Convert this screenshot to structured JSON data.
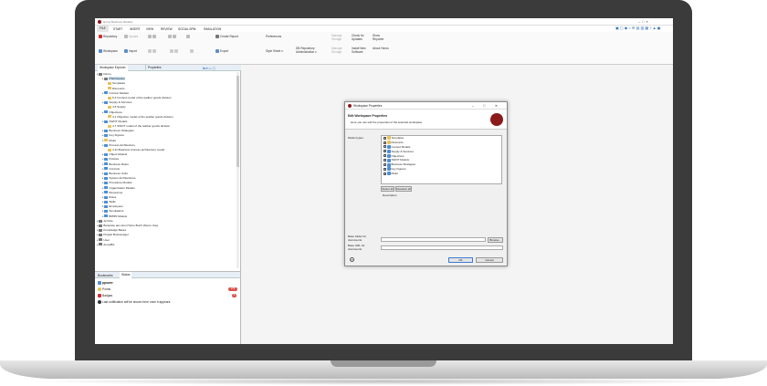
{
  "window": {
    "title": "Horus Business Modeler"
  },
  "menu": [
    "FILE",
    "START",
    "INSERT",
    "VIEW",
    "REVIEW",
    "SOCIAL BPM",
    "SIMULATION"
  ],
  "ribbon": {
    "repository": "Repository",
    "upload": "Upload",
    "import": "Import",
    "workspace": "Workspace",
    "create_report": "Create Report",
    "preferences": "Preferences",
    "style_sheet": "Style Sheet",
    "db_repository": "DB Repository Administration",
    "check_updates": "Check for Updates",
    "install_new_software": "Install New Software",
    "show_reporter": "Show Reporter",
    "about_horus": "About Horus",
    "export": "Export",
    "manage_storage": "Manage Storage",
    "manage_storage2": "Manage Storage"
  },
  "explorer": {
    "tabs": [
      "Workspace Explorer",
      "Properties"
    ],
    "tree": [
      {
        "label": "Demo",
        "level": 0,
        "color": "#7a7a7a"
      },
      {
        "label": "PWorkspace",
        "level": 1,
        "color": "#7a7a7a",
        "selected": true
      },
      {
        "label": "Templates",
        "level": 2,
        "color": "#e6c35a"
      },
      {
        "label": "Discounts",
        "level": 2,
        "color": "#e6c35a"
      },
      {
        "label": "Context Models",
        "level": 1,
        "color": "#4a8fd6"
      },
      {
        "label": "6.4 Context model of the leather goods division",
        "level": 2,
        "color": "#e6c35a"
      },
      {
        "label": "Supply & Services",
        "level": 1,
        "color": "#4a8fd6"
      },
      {
        "label": "4.5 Supply",
        "level": 2,
        "color": "#e6c35a"
      },
      {
        "label": "Objectives",
        "level": 1,
        "color": "#4a8fd6"
      },
      {
        "label": "4.1 Objective model of the leather goods division",
        "level": 2,
        "color": "#e6c35a"
      },
      {
        "label": "SWOT Models",
        "level": 1,
        "color": "#4a8fd6"
      },
      {
        "label": "4.7 SWOT model of the leather goods division",
        "level": 2,
        "color": "#e6c35a"
      },
      {
        "label": "Business Strategies",
        "level": 1,
        "color": "#4a8fd6"
      },
      {
        "label": "Key Figures",
        "level": 1,
        "color": "#4a8fd6"
      },
      {
        "label": "Risks",
        "level": 1,
        "color": "#e6c35a"
      },
      {
        "label": "Process Architecture",
        "level": 1,
        "color": "#4a8fd6"
      },
      {
        "label": "4.11 Business process architecture model",
        "level": 2,
        "color": "#e6c35a"
      },
      {
        "label": "Object Models",
        "level": 1,
        "color": "#4a8fd6"
      },
      {
        "label": "Policies",
        "level": 1,
        "color": "#4a8fd6"
      },
      {
        "label": "Business Rules",
        "level": 1,
        "color": "#4a8fd6"
      },
      {
        "label": "Controls",
        "level": 1,
        "color": "#4a8fd6"
      },
      {
        "label": "Business Units",
        "level": 1,
        "color": "#4a8fd6"
      },
      {
        "label": "System Architectures",
        "level": 1,
        "color": "#4a8fd6"
      },
      {
        "label": "Procedure Models",
        "level": 1,
        "color": "#4a8fd6"
      },
      {
        "label": "Organization Models",
        "level": 1,
        "color": "#4a8fd6"
      },
      {
        "label": "Resources",
        "level": 1,
        "color": "#4a8fd6"
      },
      {
        "label": "Roles",
        "level": 1,
        "color": "#4a8fd6"
      },
      {
        "label": "Skills",
        "level": 1,
        "color": "#4a8fd6"
      },
      {
        "label": "Employees",
        "level": 1,
        "color": "#4a8fd6"
      },
      {
        "label": "Simulations",
        "level": 1,
        "color": "#4a8fd6"
      },
      {
        "label": "BPMN Models",
        "level": 1,
        "color": "#4a8fd6"
      },
      {
        "label": "Archive",
        "level": 0,
        "color": "#7a7a7a"
      },
      {
        "label": "Beispiele aus dem Horus Buch (Demo Use)",
        "level": 0,
        "color": "#7a7a7a"
      },
      {
        "label": "Knowledge Bases",
        "level": 0,
        "color": "#7a7a7a"
      },
      {
        "label": "Projekt Businessgel",
        "level": 0,
        "color": "#7a7a7a"
      },
      {
        "label": "User",
        "level": 0,
        "color": "#7a7a7a"
      },
      {
        "label": "demoBis",
        "level": 0,
        "color": "#7a7a7a"
      }
    ]
  },
  "status": {
    "tabs": [
      "Bookmarks",
      "Status"
    ],
    "user": "ppower",
    "points_label": "Points",
    "points_value": "275",
    "badges_label": "Badges",
    "badges_value": "5",
    "notification": "Last notification will be shown here once it appears"
  },
  "dialog": {
    "title": "Workspace Properties",
    "heading": "Edit Workspace Properties",
    "subheading": "Here you can edit the properties of the selected workspace.",
    "model_types_label": "Model types:",
    "model_types": [
      "Templates",
      "Discounts",
      "Context Models",
      "Supply & Services",
      "Objectives",
      "SWOT Models",
      "Business Strategies",
      "Key Figures",
      "Risks"
    ],
    "select_all": "Select all",
    "deselect_all": "Deselect all",
    "description_label": "Description",
    "base_folder_label": "Base folder for documents",
    "base_url_label": "Base URL for documents",
    "browse": "Browse...",
    "ok": "OK",
    "cancel": "Cancel",
    "help": "?"
  },
  "colors": {
    "bezel": "#3b3b3b",
    "accent": "#8b1a1a",
    "selection": "#cde4f7"
  }
}
